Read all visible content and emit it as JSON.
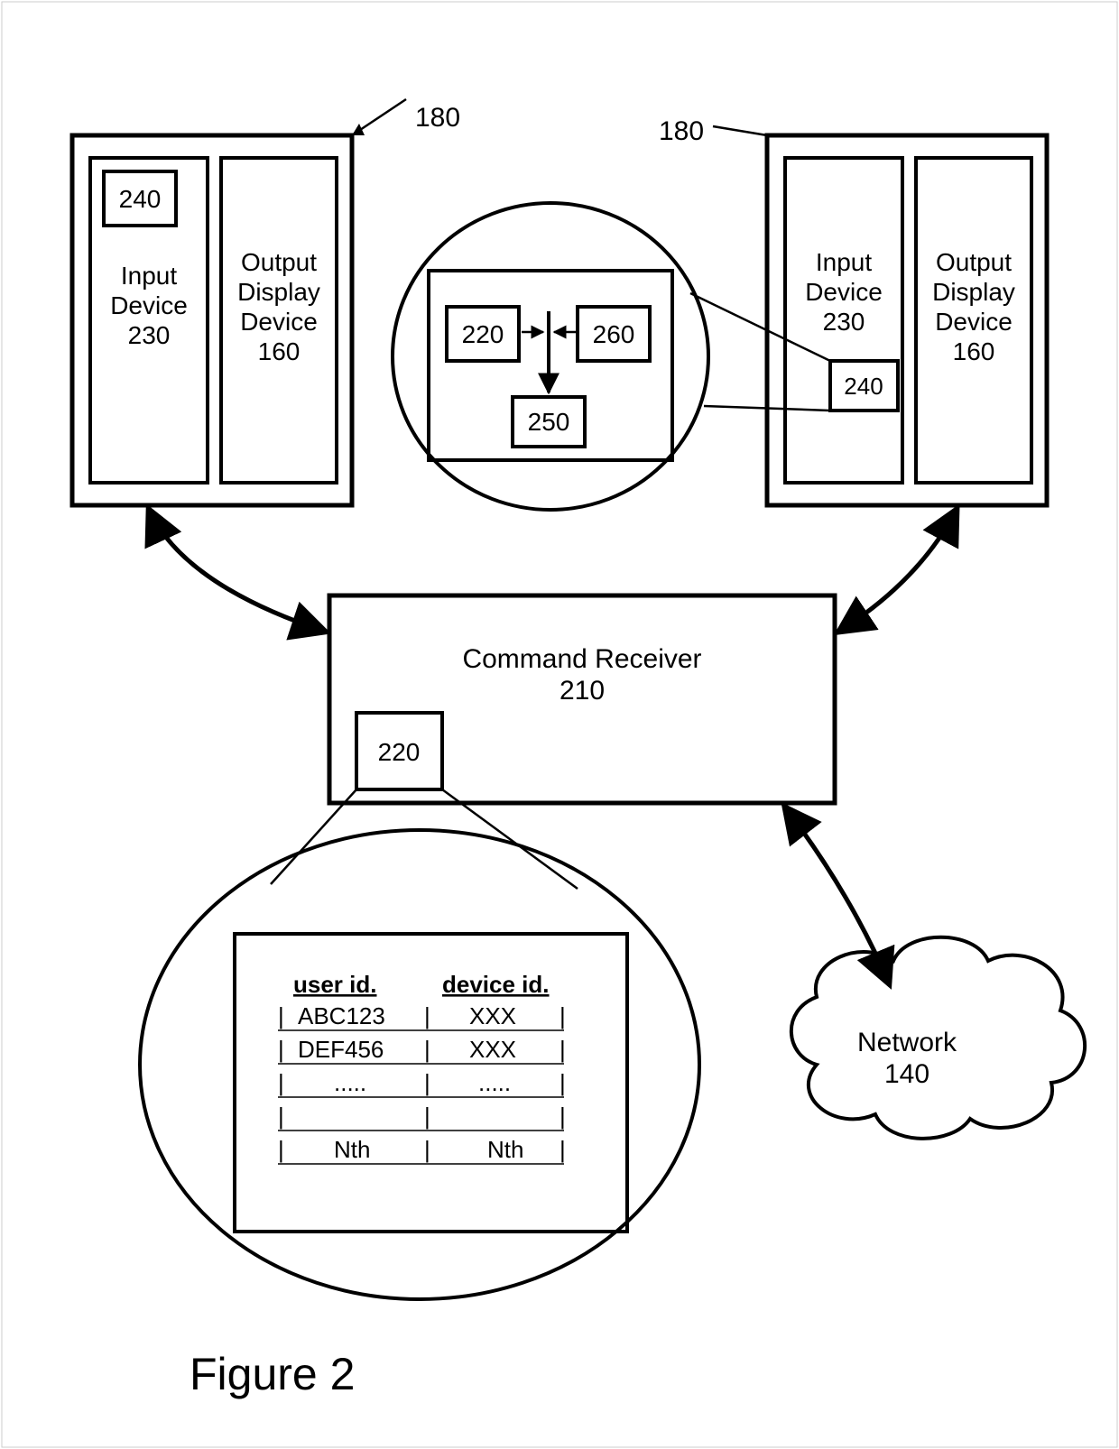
{
  "figure_label": "Figure 2",
  "terminal_left": {
    "ref": "180",
    "input_device": {
      "label": "Input Device",
      "ref": "230"
    },
    "output_device": {
      "label": "Output Display Device",
      "ref": "160"
    },
    "sub_box": {
      "ref": "240"
    }
  },
  "terminal_right": {
    "ref": "180",
    "input_device": {
      "label": "Input Device",
      "ref": "230"
    },
    "output_device": {
      "label": "Output Display Device",
      "ref": "160"
    },
    "sub_box": {
      "ref": "240"
    }
  },
  "detail_top": {
    "box_left": {
      "ref": "220"
    },
    "box_right": {
      "ref": "260"
    },
    "box_bottom": {
      "ref": "250"
    }
  },
  "command_receiver": {
    "label": "Command Receiver",
    "ref": "210",
    "sub_box": {
      "ref": "220"
    }
  },
  "detail_bottom_table": {
    "headers": {
      "col1": "user id.",
      "col2": "device id."
    },
    "rows": [
      {
        "col1": "ABC123",
        "col2": "XXX"
      },
      {
        "col1": "DEF456",
        "col2": "XXX"
      },
      {
        "col1": ".....",
        "col2": "....."
      },
      {
        "col1": "",
        "col2": ""
      },
      {
        "col1": "Nth",
        "col2": "Nth"
      }
    ]
  },
  "network": {
    "label": "Network",
    "ref": "140"
  }
}
